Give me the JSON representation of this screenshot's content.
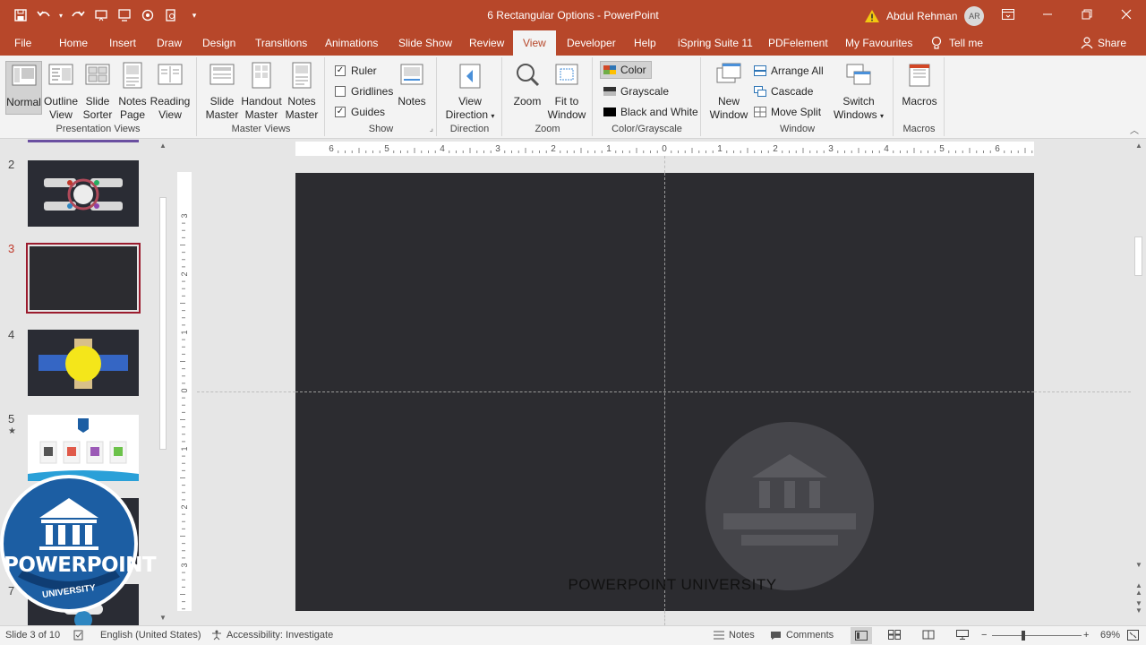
{
  "window": {
    "title": "6 Rectangular Options  -  PowerPoint",
    "user_name": "Abdul Rehman",
    "user_initials": "AR",
    "share_label": "Share",
    "tell_me": "Tell me"
  },
  "tabs": [
    {
      "label": "File"
    },
    {
      "label": "Home"
    },
    {
      "label": "Insert"
    },
    {
      "label": "Draw"
    },
    {
      "label": "Design"
    },
    {
      "label": "Transitions"
    },
    {
      "label": "Animations"
    },
    {
      "label": "Slide Show"
    },
    {
      "label": "Review"
    },
    {
      "label": "View"
    },
    {
      "label": "Developer"
    },
    {
      "label": "Help"
    },
    {
      "label": "iSpring Suite 11"
    },
    {
      "label": "PDFelement"
    },
    {
      "label": "My Favourites"
    }
  ],
  "active_tab": "View",
  "ribbon": {
    "presentation_views": {
      "label": "Presentation Views",
      "normal": "Normal",
      "outline_view": [
        "Outline",
        "View"
      ],
      "slide_sorter": [
        "Slide",
        "Sorter"
      ],
      "notes_page": [
        "Notes",
        "Page"
      ],
      "reading_view": [
        "Reading",
        "View"
      ]
    },
    "master_views": {
      "label": "Master Views",
      "slide_master": [
        "Slide",
        "Master"
      ],
      "handout_master": [
        "Handout",
        "Master"
      ],
      "notes_master": [
        "Notes",
        "Master"
      ]
    },
    "show": {
      "label": "Show",
      "ruler": "Ruler",
      "ruler_checked": true,
      "gridlines": "Gridlines",
      "gridlines_checked": false,
      "guides": "Guides",
      "guides_checked": true,
      "notes": "Notes"
    },
    "direction": {
      "label": "Direction",
      "view_direction": [
        "View",
        "Direction"
      ]
    },
    "zoom": {
      "label": "Zoom",
      "zoom": "Zoom",
      "fit_to_window": [
        "Fit to",
        "Window"
      ]
    },
    "color_grayscale": {
      "label": "Color/Grayscale",
      "color": "Color",
      "grayscale": "Grayscale",
      "black_and_white": "Black and White"
    },
    "window": {
      "label": "Window",
      "new_window": [
        "New",
        "Window"
      ],
      "arrange_all": "Arrange All",
      "cascade": "Cascade",
      "move_split": "Move Split",
      "switch_windows": [
        "Switch",
        "Windows"
      ]
    },
    "macros": {
      "label": "Macros",
      "macros": "Macros"
    }
  },
  "thumbnails": [
    {
      "num": "2"
    },
    {
      "num": "3"
    },
    {
      "num": "4"
    },
    {
      "num": "5"
    },
    {
      "num": "7"
    }
  ],
  "horizontal_ruler": [
    "6",
    "5",
    "4",
    "3",
    "2",
    "1",
    "0",
    "1",
    "2",
    "3",
    "4",
    "5",
    "6"
  ],
  "vertical_ruler": [
    "3",
    "2",
    "1",
    "0",
    "1",
    "2",
    "3"
  ],
  "slide": {
    "caption": "POWERPOINT UNIVERSITY"
  },
  "logo": {
    "text": "POWERPOINT",
    "subtext": "UNIVERSITY"
  },
  "status": {
    "slide_info": "Slide 3 of 10",
    "language": "English (United States)",
    "accessibility": "Accessibility: Investigate",
    "notes": "Notes",
    "comments": "Comments",
    "zoom": "69%"
  },
  "colors": {
    "accent": "#b7472a",
    "slide_bg": "#2c2c30",
    "selected_thumb_border": "#9b1c2e"
  }
}
